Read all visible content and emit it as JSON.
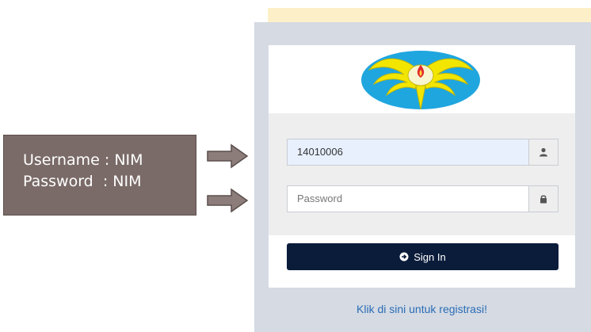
{
  "callout": {
    "line1": "Username : NIM",
    "line2": "Password  : NIM"
  },
  "login": {
    "username_value": "14010006",
    "password_placeholder": "Password",
    "sign_in_label": "Sign In",
    "register_link": "Klik di sini untuk registrasi!"
  },
  "icons": {
    "user": "user-icon",
    "lock": "lock-icon",
    "sign_in": "arrow-circle-right-icon",
    "logo": "university-emblem-icon"
  },
  "colors": {
    "callout_bg": "#7a6b68",
    "panel_bg": "#d5dae3",
    "button_bg": "#0b1c3a",
    "link": "#2a6db5",
    "autofill_bg": "#e8f0fe"
  }
}
